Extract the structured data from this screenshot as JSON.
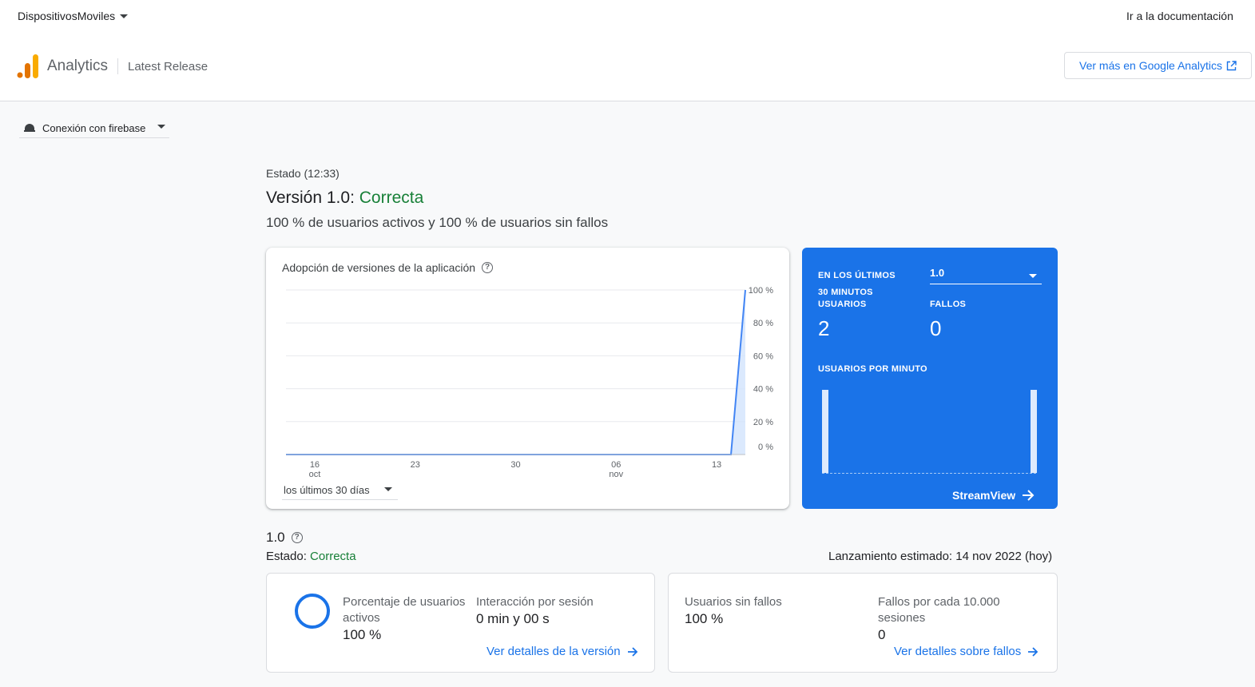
{
  "header": {
    "project": "DispositivosMoviles",
    "docs_link": "Ir a la documentación",
    "product": "Analytics",
    "release": "Latest Release",
    "ga_button": "Ver más en Google Analytics"
  },
  "app_selector": {
    "label": "Conexión con firebase",
    "icon": "android-icon"
  },
  "status": {
    "time": "Estado (12:33)",
    "version_prefix": "Versión 1.0:",
    "state": "Correcta",
    "summary": "100 % de usuarios activos y 100 % de usuarios sin fallos"
  },
  "adoption": {
    "title": "Adopción de versiones de la aplicación",
    "range": "los últimos 30 días"
  },
  "chart_data": {
    "type": "area",
    "title": "Adopción de versiones de la aplicación",
    "x_ticks": [
      {
        "top": "16",
        "bottom": "oct"
      },
      {
        "top": "23",
        "bottom": ""
      },
      {
        "top": "30",
        "bottom": ""
      },
      {
        "top": "06",
        "bottom": "nov"
      },
      {
        "top": "13",
        "bottom": ""
      }
    ],
    "y_ticks": [
      "100 %",
      "80 %",
      "60 %",
      "40 %",
      "20 %",
      "0 %"
    ],
    "ylim": [
      0,
      100
    ],
    "x": [
      "2022-10-14",
      "2022-10-21",
      "2022-10-28",
      "2022-11-04",
      "2022-11-11",
      "2022-11-14",
      "2022-11-15"
    ],
    "series": [
      {
        "values": [
          0,
          0,
          0,
          0,
          0,
          0,
          100
        ]
      }
    ],
    "grid": true
  },
  "realtime": {
    "window_label_1": "EN LOS ÚLTIMOS",
    "window_label_2": "30 MINUTOS",
    "version": "1.0",
    "users_label": "USUARIOS",
    "users_value": "2",
    "crashes_label": "FALLOS",
    "crashes_value": "0",
    "per_minute_label": "USUARIOS POR MINUTO",
    "per_minute": [
      1,
      0,
      0,
      0,
      0,
      0,
      0,
      0,
      0,
      0,
      0,
      0,
      0,
      0,
      0,
      0,
      0,
      0,
      0,
      0,
      0,
      0,
      0,
      0,
      0,
      0,
      0,
      0,
      0,
      1
    ],
    "streamview": "StreamView"
  },
  "version_section": {
    "version": "1.0",
    "status_prefix": "Estado:",
    "status": "Correcta",
    "launch": "Lanzamiento estimado: 14 nov 2022 (hoy)"
  },
  "metrics": {
    "active_pct_label": "Porcentaje de usuarios activos",
    "active_pct_value": "100 %",
    "engagement_label": "Interacción por sesión",
    "engagement_value": "0 min y 00 s",
    "version_link": "Ver detalles de la versión",
    "crash_free_label": "Usuarios sin fallos",
    "crash_free_value": "100 %",
    "crashes_per_10k_label": "Fallos por cada 10.000 sesiones",
    "crashes_per_10k_value": "0",
    "crash_link": "Ver detalles sobre fallos"
  },
  "colors": {
    "accent": "#1a73e8",
    "ok": "#188038",
    "logo_orange": "#f9ab00",
    "logo_dark": "#e37400"
  }
}
